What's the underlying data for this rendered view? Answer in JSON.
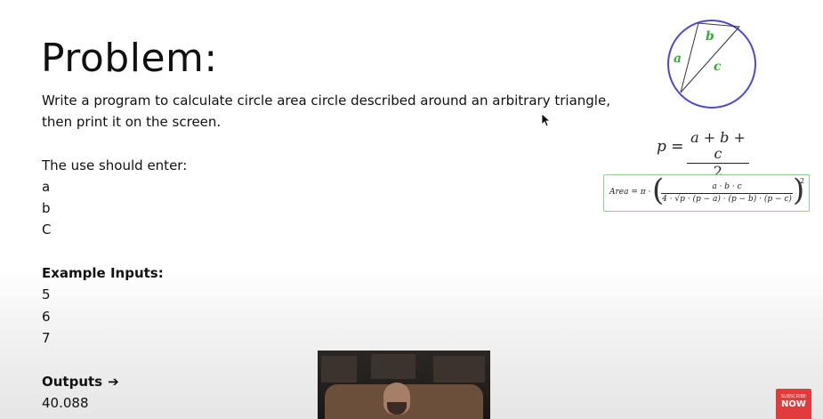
{
  "slide": {
    "title": "Problem:",
    "description_line1": "Write a program to calculate  circle area circle described around an arbitrary triangle,",
    "description_line2": "then print it on the screen.",
    "inputs_heading": "The use should enter:",
    "inputs": [
      "a",
      "b",
      "C"
    ],
    "example_heading": "Example Inputs:",
    "example_values": [
      "5",
      "6",
      "7"
    ],
    "outputs_heading": "Outputs",
    "output_value": "40.088"
  },
  "diagram": {
    "labels": {
      "a": "a",
      "b": "b",
      "c": "c"
    },
    "circle_color": "#4a4ad0",
    "label_color": "#3aa83a"
  },
  "formulas": {
    "p_lhs": "p =",
    "p_numerator": "a + b + c",
    "p_denominator": "2",
    "area_lhs": "Area = π ·",
    "area_numerator": "a · b · c",
    "area_denominator": "4 · √p · (p − a) · (p − b) · (p − c)",
    "area_exponent": "2",
    "box_border_color": "#8ccf8c"
  },
  "subscribe": {
    "small_text": "SUBSCRIBE",
    "big_text": "NOW",
    "color": "#e23b3b"
  }
}
